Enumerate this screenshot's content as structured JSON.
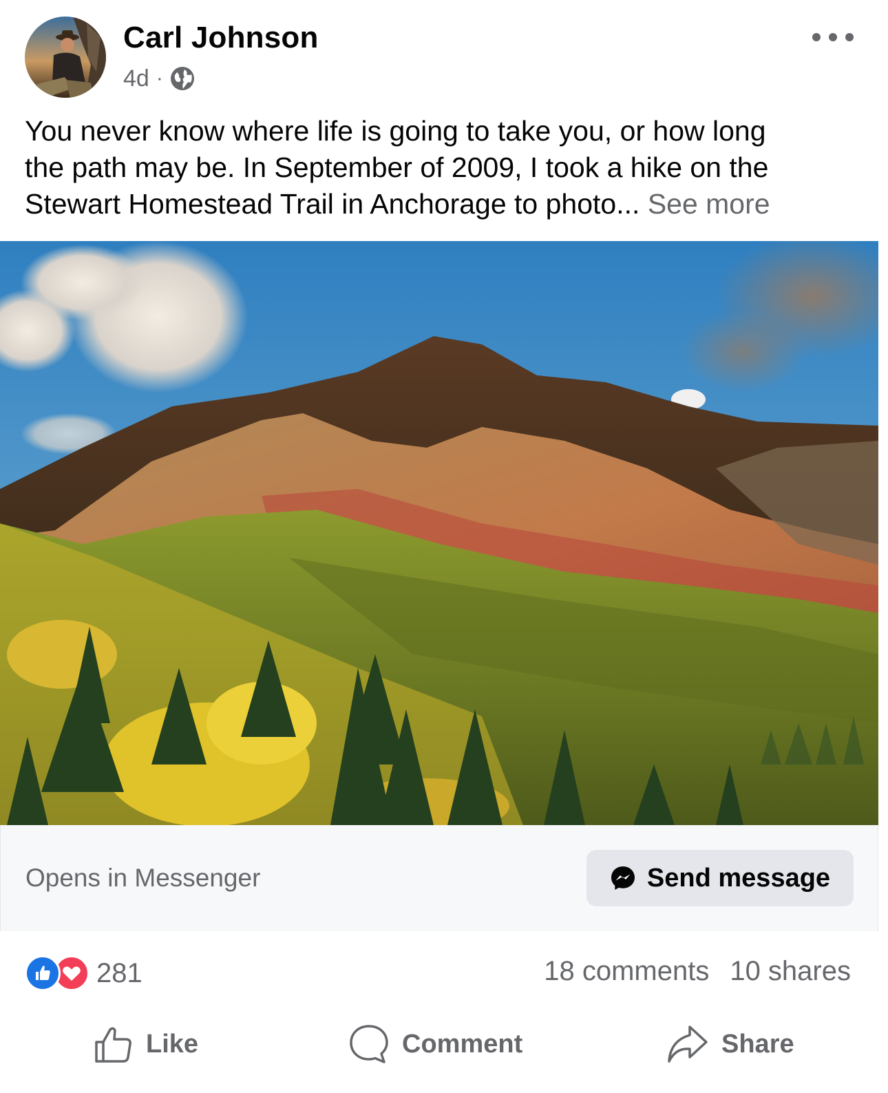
{
  "post": {
    "author": "Carl Johnson",
    "time": "4d",
    "separator": "·",
    "privacy_icon": "globe-icon",
    "more_icon": "more-options-icon",
    "caption_lines": [
      "You never know where life is going to take you, or how long",
      "the path may be. In September of 2009, I took a hike on the",
      "Stewart Homestead Trail in Anchorage to photo..."
    ],
    "see_more": "See more",
    "photo_icon": "mountain-landscape-photo"
  },
  "messenger": {
    "opens_label": "Opens in Messenger",
    "send_label": "Send message",
    "icon": "messenger-icon"
  },
  "stats": {
    "reaction_icons": [
      "like-reaction-icon",
      "love-reaction-icon"
    ],
    "reaction_count": "281",
    "comments": "18 comments",
    "shares": "10 shares"
  },
  "actions": {
    "like": "Like",
    "comment": "Comment",
    "share": "Share"
  },
  "colors": {
    "text_primary": "#050505",
    "text_secondary": "#65676b",
    "like_blue": "#1b74e4",
    "love_red": "#f33e58",
    "button_gray": "#e4e6eb",
    "bar_bg": "#f7f8fa"
  }
}
